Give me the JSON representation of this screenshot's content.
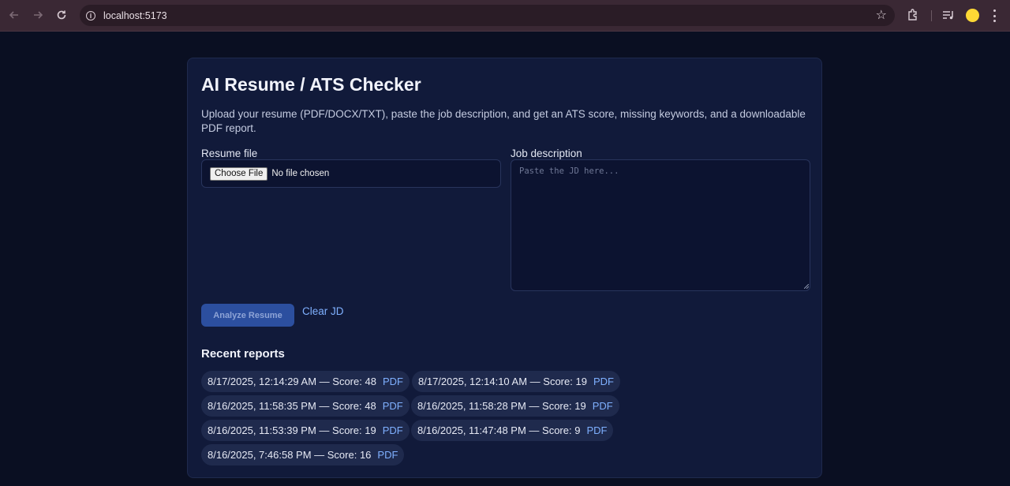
{
  "browser": {
    "url": "localhost:5173"
  },
  "app": {
    "title": "AI Resume / ATS Checker",
    "subtitle": "Upload your resume (PDF/DOCX/TXT), paste the job description, and get an ATS score, missing keywords, and a downloadable PDF report."
  },
  "form": {
    "resume_label": "Resume file",
    "choose_file_label": "Choose File",
    "no_file_text": "No file chosen",
    "jd_label": "Job description",
    "jd_placeholder": "Paste the JD here...",
    "jd_value": "",
    "analyze_label": "Analyze Resume",
    "clear_label": "Clear JD"
  },
  "recent": {
    "title": "Recent reports",
    "pdf_label": "PDF",
    "items": [
      {
        "text": "8/17/2025, 12:14:29 AM — Score: 48"
      },
      {
        "text": "8/17/2025, 12:14:10 AM — Score: 19"
      },
      {
        "text": "8/16/2025, 11:58:35 PM — Score: 48"
      },
      {
        "text": "8/16/2025, 11:58:28 PM — Score: 19"
      },
      {
        "text": "8/16/2025, 11:53:39 PM — Score: 19"
      },
      {
        "text": "8/16/2025, 11:47:48 PM — Score: 9"
      },
      {
        "text": "8/16/2025, 7:46:58 PM — Score: 16"
      }
    ]
  },
  "colors": {
    "page_bg": "#0a0f22",
    "card_bg": "#111a3a",
    "accent": "#2c4f9f",
    "link": "#7fb0ff"
  }
}
